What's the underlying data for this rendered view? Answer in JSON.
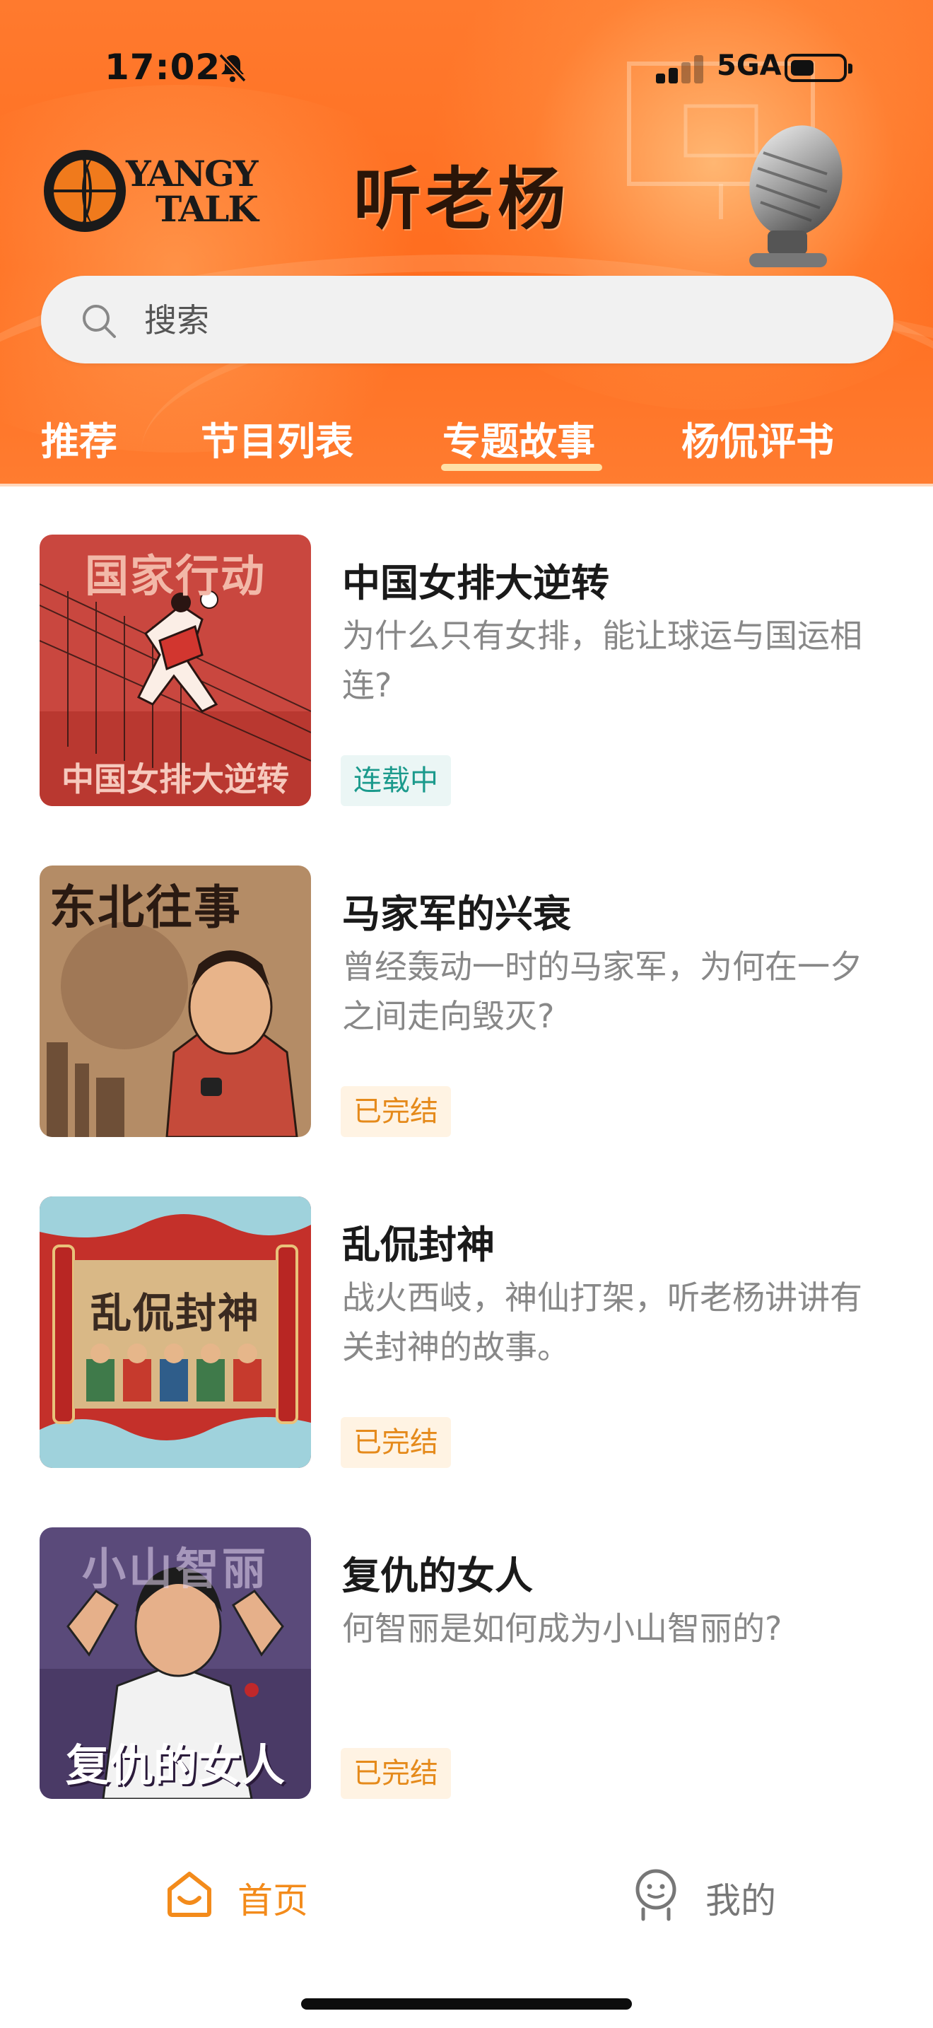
{
  "status_bar": {
    "time": "17:02",
    "network": "5GA",
    "icons": [
      "bell-off-icon",
      "signal-icon",
      "battery-icon"
    ]
  },
  "header": {
    "logo_line1": "YANGY",
    "logo_line2": "TALK",
    "title": "听老杨",
    "accent_color": "#ff6d1f"
  },
  "search": {
    "placeholder": "搜索"
  },
  "tabs": [
    {
      "label": "推荐",
      "active": false
    },
    {
      "label": "节目列表",
      "active": false
    },
    {
      "label": "专题故事",
      "active": true
    },
    {
      "label": "杨侃评书",
      "active": false
    }
  ],
  "items": [
    {
      "cover_text": "国家行动",
      "cover_caption": "中国女排大逆转",
      "title": "中国女排大逆转",
      "desc": "为什么只有女排，能让球运与国运相连?",
      "status": "连载中",
      "status_type": "ongoing"
    },
    {
      "cover_text": "东北往事",
      "cover_caption": "",
      "title": "马家军的兴衰",
      "desc": "曾经轰动一时的马家军，为何在一夕之间走向毁灭?",
      "status": "已完结",
      "status_type": "done"
    },
    {
      "cover_text": "乱侃封神",
      "cover_caption": "",
      "title": "乱侃封神",
      "desc": "战火西岐，神仙打架，听老杨讲讲有关封神的故事。",
      "status": "已完结",
      "status_type": "done"
    },
    {
      "cover_text": "小山智丽",
      "cover_caption": "复仇的女人",
      "title": "复仇的女人",
      "desc": "何智丽是如何成为小山智丽的?",
      "status": "已完结",
      "status_type": "done"
    }
  ],
  "bottom_nav": [
    {
      "label": "首页",
      "icon": "home-icon",
      "active": true
    },
    {
      "label": "我的",
      "icon": "profile-icon",
      "active": false
    }
  ]
}
